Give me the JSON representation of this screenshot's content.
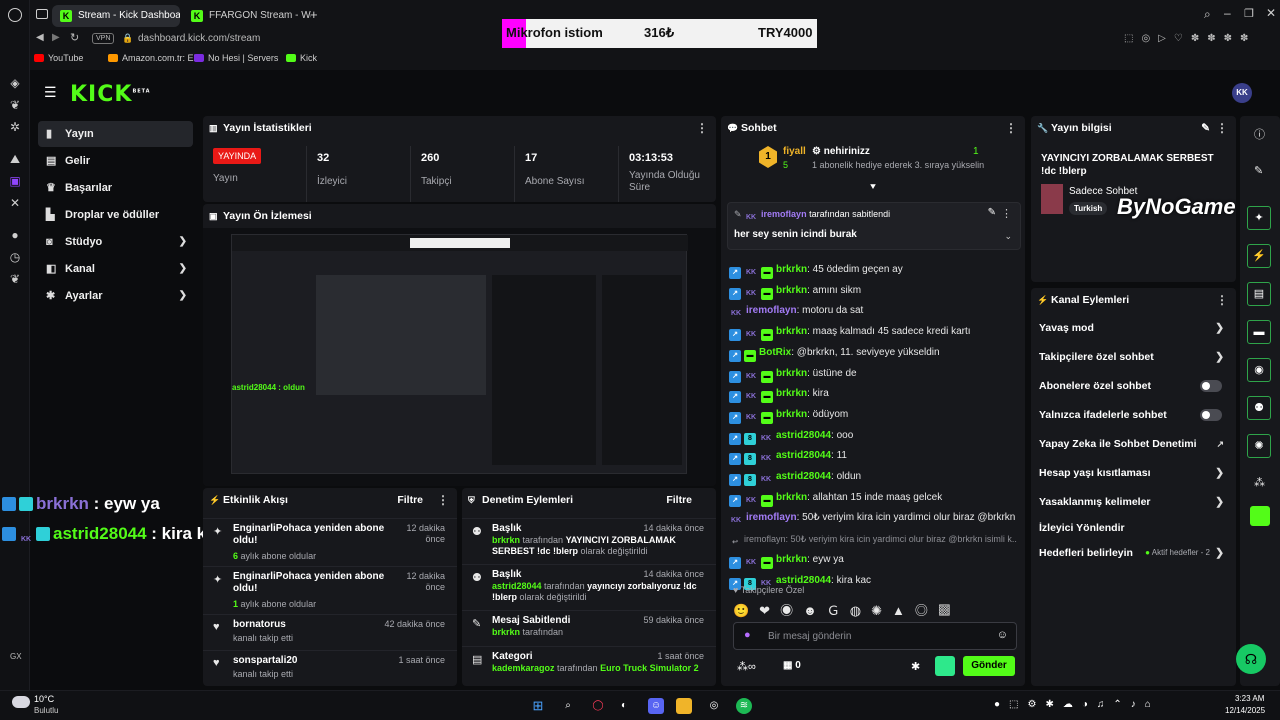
{
  "browser": {
    "tabs": [
      {
        "label": "Stream - Kick Dashboard"
      },
      {
        "label": "FFARGON Stream - Watc"
      }
    ],
    "vpn": "VPN",
    "url": "dashboard.kick.com/stream",
    "bookmarks": [
      "YouTube",
      "Amazon.com.tr: El...",
      "No Hesi | Servers",
      "Kick"
    ]
  },
  "stream_overlay": {
    "goal_label": "Mikrofon istiom",
    "goal_current": "316₺",
    "goal_target": "TRY4000"
  },
  "header": {
    "logo": "KICK",
    "logo_sup": "BETA",
    "avatar": "KK"
  },
  "sidebar": {
    "items": [
      {
        "label": "Yayın"
      },
      {
        "label": "Gelir"
      },
      {
        "label": "Başarılar"
      },
      {
        "label": "Droplar ve ödüller"
      },
      {
        "label": "Stüdyo"
      },
      {
        "label": "Kanal"
      },
      {
        "label": "Ayarlar"
      }
    ],
    "gx": "GX"
  },
  "stats": {
    "title": "Yayın İstatistikleri",
    "live_badge": "YAYINDA",
    "live_label": "Yayın",
    "items": [
      {
        "value": "32",
        "label": "İzleyici"
      },
      {
        "value": "260",
        "label": "Takipçi"
      },
      {
        "value": "17",
        "label": "Abone Sayısı"
      },
      {
        "value": "03:13:53",
        "label": "Yayında Olduğu Süre"
      }
    ]
  },
  "preview": {
    "title": "Yayın Ön İzlemesi"
  },
  "activity": {
    "title": "Etkinlik Akışı",
    "filter": "Filtre",
    "items": [
      {
        "title": "EnginarliPohaca yeniden abone oldu!",
        "sub_highlight": "6",
        "sub": " aylık abone oldular",
        "time": "12 dakika önce"
      },
      {
        "title": "EnginarliPohaca yeniden abone oldu!",
        "sub_highlight": "1",
        "sub": " aylık abone oldular",
        "time": "12 dakika önce"
      },
      {
        "title": "bornatorus",
        "sub_highlight": "",
        "sub": "kanalı takip etti",
        "time": "42 dakika önce"
      },
      {
        "title": "sonspartali20",
        "sub_highlight": "",
        "sub": "kanalı takip etti",
        "time": "1 saat önce"
      }
    ]
  },
  "moderation": {
    "title": "Denetim Eylemleri",
    "filter": "Filtre",
    "items": [
      {
        "title": "Başlık",
        "time": "14 dakika önce",
        "user": "brkrkn",
        "mid": " tarafından ",
        "value": "YAYINCIYI ZORBALAMAK SERBEST !dc !blerp",
        "end": " olarak değiştirildi"
      },
      {
        "title": "Başlık",
        "time": "14 dakika önce",
        "user": "astrid28044",
        "mid": " tarafından ",
        "value": "yayıncıyı zorbalıyoruz !dc !blerp",
        "end": " olarak değiştirildi"
      },
      {
        "title": "Mesaj Sabitlendi",
        "time": "59 dakika önce",
        "user": "brkrkn",
        "mid": " tarafından",
        "value": "",
        "end": ""
      },
      {
        "title": "Kategori",
        "time": "1 saat önce",
        "user": "kademkaragoz",
        "mid": " tarafından ",
        "value": "Euro Truck Simulator 2",
        "end": ""
      }
    ]
  },
  "chat": {
    "title": "Sohbet",
    "top_gifter": {
      "rank": "1",
      "name": "fiyall",
      "count": "5"
    },
    "gift_info": {
      "name": "nehirinizz",
      "count": "1",
      "text": "1 abonelik hediye ederek 3. sıraya yükselin"
    },
    "pinned": {
      "by": "iremoflayn",
      "by_suffix": " tarafından sabitlendi",
      "message": "her sey senin icindi burak"
    },
    "messages": [
      {
        "user": "brkrkn",
        "color": "#53fc18",
        "text": ": 45 ödedim geçen ay",
        "badges": [
          "blue",
          "kk",
          "green"
        ]
      },
      {
        "user": "brkrkn",
        "color": "#53fc18",
        "text": ": amını sikm",
        "badges": [
          "blue",
          "kk",
          "green"
        ]
      },
      {
        "user": "iremoflayn",
        "color": "#a27bf5",
        "text": ": motoru da sat",
        "badges": [
          "kk"
        ]
      },
      {
        "user": "brkrkn",
        "color": "#53fc18",
        "text": ": maaş kalmadı 45 sadece kredi kartı",
        "badges": [
          "blue",
          "kk",
          "green"
        ]
      },
      {
        "user": "BotRix",
        "color": "#53fc18",
        "text": ": @brkrkn, 11. seviyeye yükseldin",
        "badges": [
          "blue",
          "green"
        ]
      },
      {
        "user": "brkrkn",
        "color": "#53fc18",
        "text": ": üstüne de",
        "badges": [
          "blue",
          "kk",
          "green"
        ]
      },
      {
        "user": "brkrkn",
        "color": "#53fc18",
        "text": ": kira",
        "badges": [
          "blue",
          "kk",
          "green"
        ]
      },
      {
        "user": "brkrkn",
        "color": "#53fc18",
        "text": ": ödüyom",
        "badges": [
          "blue",
          "kk",
          "green"
        ]
      },
      {
        "user": "astrid28044",
        "color": "#53fc18",
        "text": ": ooo",
        "badges": [
          "blue",
          "cyan",
          "kk"
        ]
      },
      {
        "user": "astrid28044",
        "color": "#53fc18",
        "text": ": 11",
        "badges": [
          "blue",
          "cyan",
          "kk"
        ]
      },
      {
        "user": "astrid28044",
        "color": "#53fc18",
        "text": ": oldun",
        "badges": [
          "blue",
          "cyan",
          "kk"
        ]
      },
      {
        "user": "brkrkn",
        "color": "#53fc18",
        "text": ": allahtan 15 inde maaş gelcek",
        "badges": [
          "blue",
          "kk",
          "green"
        ]
      },
      {
        "user": "iremoflayn",
        "color": "#a27bf5",
        "text": ": 50₺ veriyim kira icin yardimci olur biraz @brkrkn",
        "badges": [
          "kk"
        ]
      },
      {
        "user": "",
        "color": "#8c8d93",
        "text": "iremoflayn: 50₺ veriyim kira icin yardimci olur biraz @brkrkn isimli k...",
        "badges": [
          "reply"
        ]
      },
      {
        "user": "brkrkn",
        "color": "#53fc18",
        "text": ": eyw ya",
        "badges": [
          "blue",
          "kk",
          "green"
        ]
      },
      {
        "user": "astrid28044",
        "color": "#53fc18",
        "text": ": kira kac",
        "badges": [
          "blue",
          "cyan",
          "kk"
        ]
      }
    ],
    "followers_only": "Takipçilere Özel",
    "input_placeholder": "Bir mesaj gönderin",
    "points": "∞",
    "gifts": "0",
    "send": "Gönder"
  },
  "stream_info": {
    "title": "Yayın bilgisi",
    "stream_title": "YAYINCIYI ZORBALAMAK SERBEST !dc !blerp",
    "category": "Sadece Sohbet",
    "tag": "Turkish",
    "watermark": "ByNoGame"
  },
  "channel_actions": {
    "title": "Kanal Eylemleri",
    "items": [
      {
        "label": "Yavaş mod",
        "control": "chevron"
      },
      {
        "label": "Takipçilere özel sohbet",
        "control": "chevron"
      },
      {
        "label": "Abonelere özel sohbet",
        "control": "toggle"
      },
      {
        "label": "Yalnızca ifadelerle sohbet",
        "control": "toggle"
      },
      {
        "label": "Yapay Zeka ile Sohbet Denetimi",
        "control": "external"
      },
      {
        "label": "Hesap yaşı kısıtlaması",
        "control": "chevron"
      },
      {
        "label": "Yasaklanmış kelimeler",
        "control": "chevron"
      },
      {
        "label": "İzleyici Yönlendir",
        "control": "none"
      },
      {
        "label": "Hedefleri belirleyin",
        "control": "chevron",
        "extra": "Aktif hedefler - 2"
      }
    ]
  },
  "stream_overlay_chat": [
    {
      "user": "brkrkn",
      "text": " : eyw ya",
      "color": "#8a70d6"
    },
    {
      "user": "astrid28044",
      "text": " : kira kac",
      "color": "#53fc18"
    }
  ],
  "taskbar": {
    "weather_temp": "10°C",
    "weather_desc": "Bulutlu",
    "time": "3:23 AM",
    "date": "12/14/2025"
  }
}
